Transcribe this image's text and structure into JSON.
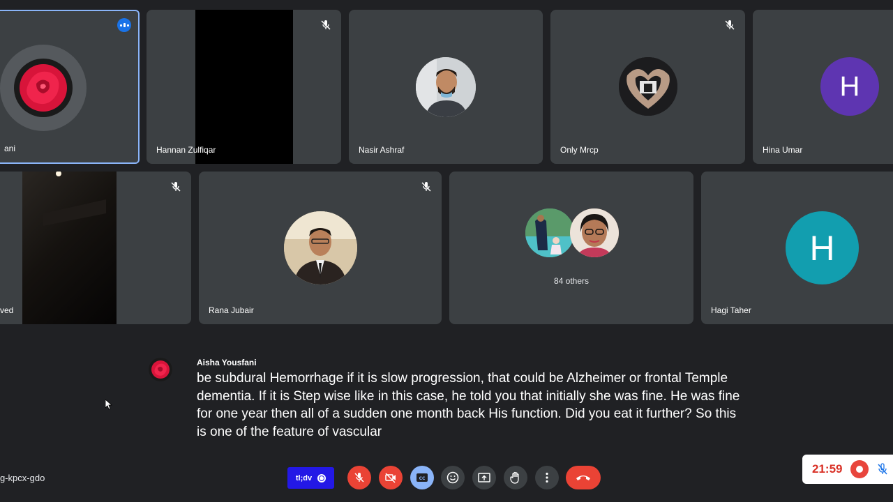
{
  "tiles": {
    "aisha": {
      "name": "ani"
    },
    "hannan": {
      "name": "Hannan Zulfiqar"
    },
    "nasir": {
      "name": "Nasir Ashraf"
    },
    "only": {
      "name": "Only Mrcp"
    },
    "hina": {
      "name": "Hina Umar",
      "initial": "H",
      "color": "#5e35b1"
    },
    "ved": {
      "name": "ved"
    },
    "rana": {
      "name": "Rana Jubair"
    },
    "others": {
      "label": "84 others"
    },
    "hagi": {
      "name": "Hagi Taher",
      "initial": "H",
      "color": "#129eaf"
    }
  },
  "caption": {
    "speaker": "Aisha Yousfani",
    "text": "be subdural Hemorrhage if it is slow progression, that could be Alzheimer or frontal Temple dementia. If it is Step wise like in this case, he told you that initially she was fine. He was fine for one year then all of a sudden one month back His function. Did you eat it further? So this is one of the feature of vascular"
  },
  "meeting_code": "g-kpcx-gdo",
  "controls": {
    "tldv_label": "tl;dv",
    "icons": [
      "mic-off-icon",
      "camera-off-icon",
      "captions-icon",
      "emoji-icon",
      "present-icon",
      "raise-hand-icon",
      "more-options-icon",
      "hangup-icon"
    ]
  },
  "recorder": {
    "time": "21:59"
  },
  "colors": {
    "background": "#202124",
    "tile": "#3c4043",
    "active_border": "#8ab4f8",
    "danger": "#ea4335"
  }
}
